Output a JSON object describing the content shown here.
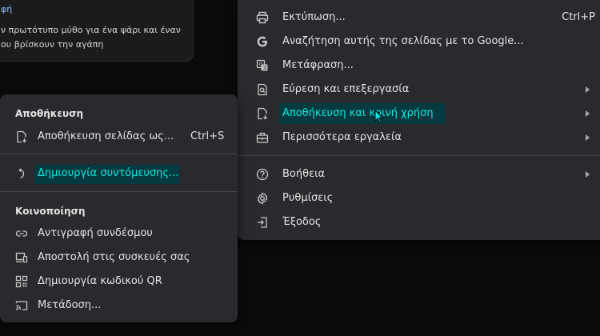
{
  "card": {
    "link": "φή",
    "line1": "ν πρωτότυπο μύθο για ένα ψάρι και έναν",
    "line2": "ου βρίσκουν την αγάπη"
  },
  "main_menu": {
    "items": [
      {
        "label": "Εκτύπωση...",
        "shortcut": "Ctrl+P",
        "icon": "printer-icon"
      },
      {
        "label": "Αναζήτηση αυτής της σελίδας με το Google...",
        "icon": "google-g-icon"
      },
      {
        "label": "Μετάφραση...",
        "icon": "translate-icon"
      },
      {
        "label": "Εύρεση και επεξεργασία",
        "icon": "find-page-icon"
      },
      {
        "label": "Αποθήκευση και κοινή χρήση",
        "icon": "save-share-icon"
      },
      {
        "label": "Περισσότερα εργαλεία",
        "icon": "toolbox-icon"
      },
      {
        "label": "Βοήθεια",
        "icon": "help-icon"
      },
      {
        "label": "Ρυθμίσεις",
        "icon": "gear-icon"
      },
      {
        "label": "Έξοδος",
        "icon": "exit-icon"
      }
    ]
  },
  "sub_menu": {
    "save_header": "Αποθήκευση",
    "save_page": {
      "label": "Αποθήκευση σελίδας ως...",
      "shortcut": "Ctrl+S"
    },
    "create_shortcut": "Δημιουργία συντόμευσης...",
    "share_header": "Κοινοποίηση",
    "copy_link": "Αντιγραφή συνδέσμου",
    "send_devices": "Αποστολή στις συσκευές σας",
    "create_qr": "Δημιουργία κωδικού QR",
    "cast": "Μετάδοση..."
  },
  "colors": {
    "menu_bg": "#292a2d",
    "highlight_bg": "#053b40",
    "highlight_text": "#13e4dc"
  }
}
